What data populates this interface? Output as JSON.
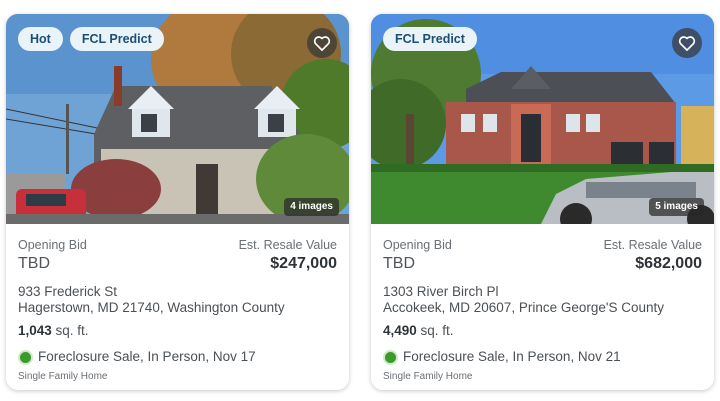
{
  "listings": [
    {
      "badges": [
        "Hot",
        "FCL Predict"
      ],
      "image_count": "4 images",
      "opening_bid_label": "Opening Bid",
      "opening_bid": "TBD",
      "resale_label": "Est. Resale Value",
      "resale_value": "$247,000",
      "address_line1": "933 Frederick St",
      "address_line2": "Hagerstown, MD 21740, Washington County",
      "sqft_value": "1,043",
      "sqft_unit": " sq. ft.",
      "sale_info": "Foreclosure Sale, In Person, Nov 17",
      "property_type": "Single Family Home",
      "favorite_icon": "heart-outline-icon"
    },
    {
      "badges": [
        "FCL Predict"
      ],
      "image_count": "5 images",
      "opening_bid_label": "Opening Bid",
      "opening_bid": "TBD",
      "resale_label": "Est. Resale Value",
      "resale_value": "$682,000",
      "address_line1": "1303 River Birch Pl",
      "address_line2": "Accokeek, MD 20607, Prince George'S County",
      "sqft_value": "4,490",
      "sqft_unit": " sq. ft.",
      "sale_info": "Foreclosure Sale, In Person, Nov 21",
      "property_type": "Single Family Home",
      "favorite_icon": "heart-outline-icon"
    }
  ],
  "colors": {
    "badge_bg": "#eaf3f8",
    "badge_text": "#1a4f76",
    "status_green": "#3a9b2b"
  }
}
